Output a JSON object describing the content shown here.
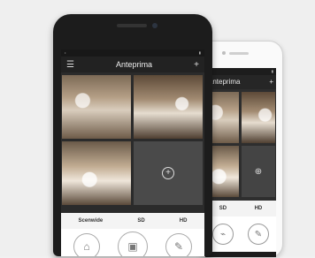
{
  "back_phone": {
    "title": "Anteprima",
    "tabs": [
      "SD",
      "HD"
    ]
  },
  "front_phone": {
    "title": "Anteprima",
    "tabs": [
      "Scenwide",
      "SD",
      "HD"
    ]
  },
  "icons": {
    "menu": "menu-icon",
    "add": "plus-icon",
    "camera": "camera-icon",
    "snapshot": "image-icon",
    "edit": "pencil-icon"
  }
}
